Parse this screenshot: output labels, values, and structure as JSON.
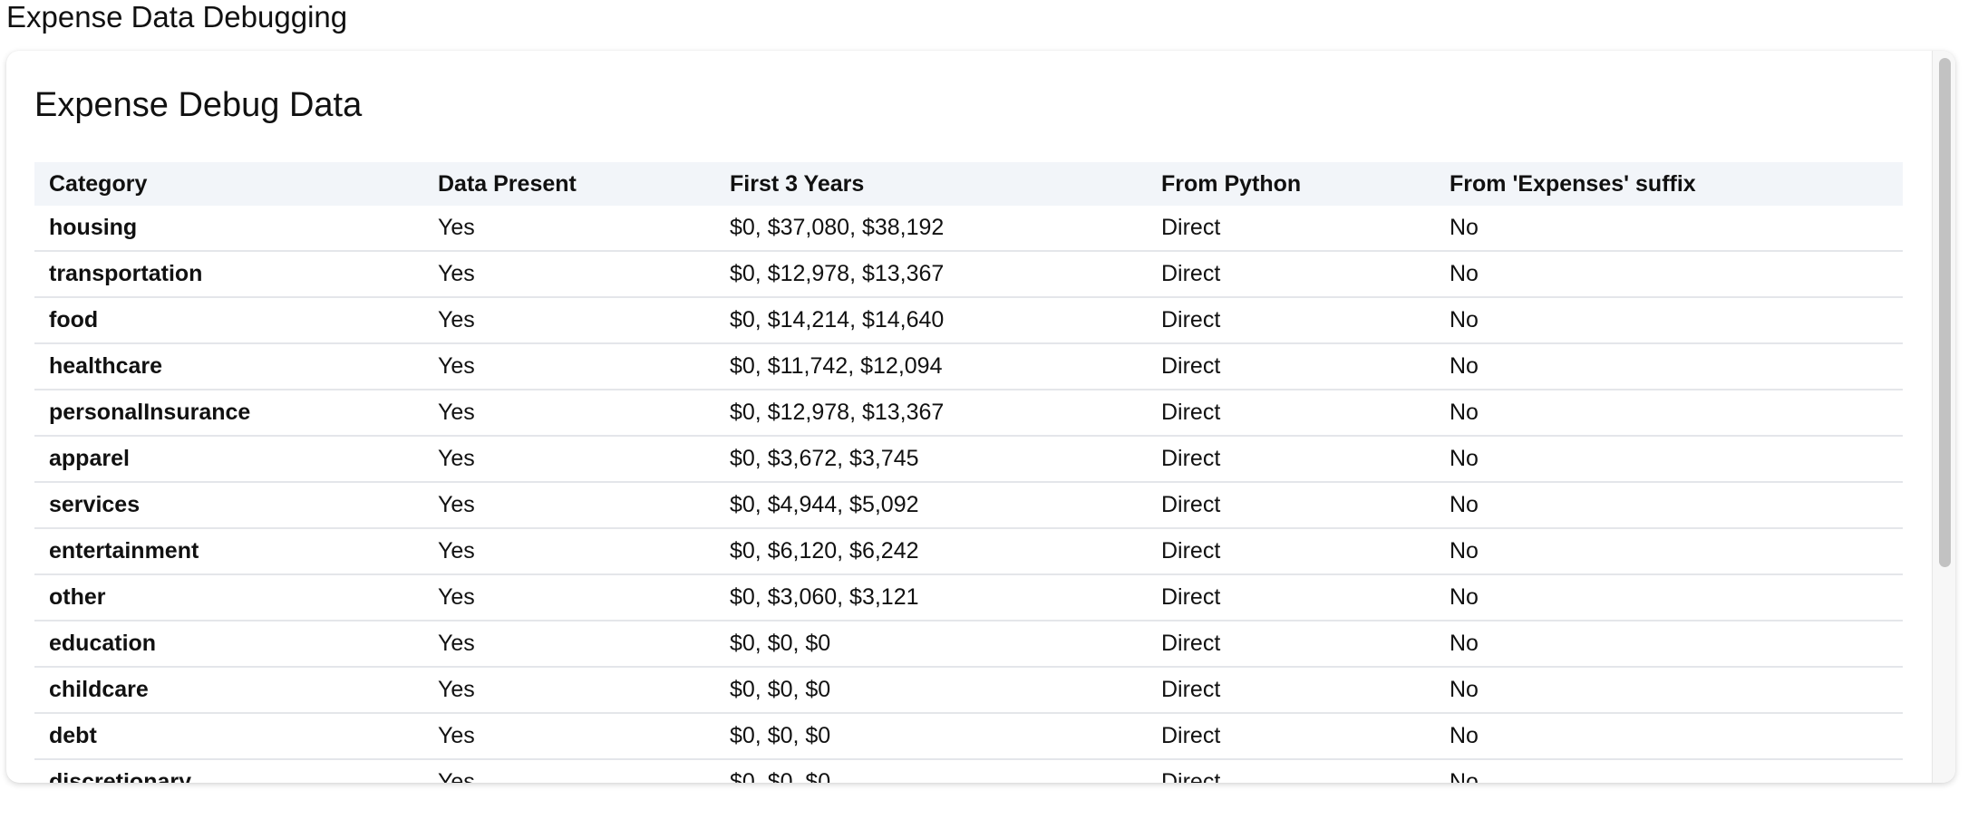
{
  "page": {
    "heading": "Expense Data Debugging"
  },
  "card": {
    "title": "Expense Debug Data"
  },
  "table": {
    "headers": [
      "Category",
      "Data Present",
      "First 3 Years",
      "From Python",
      "From 'Expenses' suffix"
    ],
    "rows": [
      [
        "housing",
        "Yes",
        "$0, $37,080, $38,192",
        "Direct",
        "No"
      ],
      [
        "transportation",
        "Yes",
        "$0, $12,978, $13,367",
        "Direct",
        "No"
      ],
      [
        "food",
        "Yes",
        "$0, $14,214, $14,640",
        "Direct",
        "No"
      ],
      [
        "healthcare",
        "Yes",
        "$0, $11,742, $12,094",
        "Direct",
        "No"
      ],
      [
        "personalInsurance",
        "Yes",
        "$0, $12,978, $13,367",
        "Direct",
        "No"
      ],
      [
        "apparel",
        "Yes",
        "$0, $3,672, $3,745",
        "Direct",
        "No"
      ],
      [
        "services",
        "Yes",
        "$0, $4,944, $5,092",
        "Direct",
        "No"
      ],
      [
        "entertainment",
        "Yes",
        "$0, $6,120, $6,242",
        "Direct",
        "No"
      ],
      [
        "other",
        "Yes",
        "$0, $3,060, $3,121",
        "Direct",
        "No"
      ],
      [
        "education",
        "Yes",
        "$0, $0, $0",
        "Direct",
        "No"
      ],
      [
        "childcare",
        "Yes",
        "$0, $0, $0",
        "Direct",
        "No"
      ],
      [
        "debt",
        "Yes",
        "$0, $0, $0",
        "Direct",
        "No"
      ],
      [
        "discretionary",
        "Yes",
        "$0, $0, $0",
        "Direct",
        "No"
      ]
    ]
  }
}
